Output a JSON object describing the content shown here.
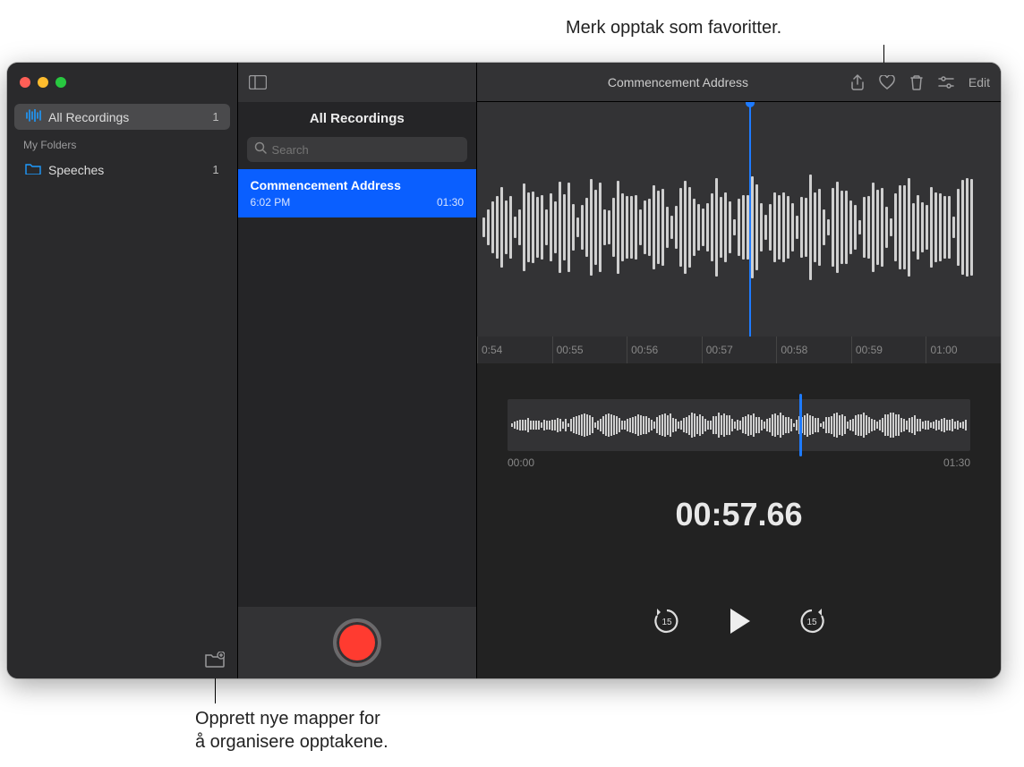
{
  "callouts": {
    "favorite": "Merk opptak som favoritter.",
    "folders_line1": "Opprett nye mapper for",
    "folders_line2": "å organisere opptakene."
  },
  "sidebar": {
    "all_recordings": "All Recordings",
    "all_count": "1",
    "group_label": "My Folders",
    "folders": [
      {
        "name": "Speeches",
        "count": "1"
      }
    ]
  },
  "list": {
    "header": "All Recordings",
    "search_placeholder": "Search",
    "recordings": [
      {
        "title": "Commencement Address",
        "time": "6:02 PM",
        "duration": "01:30"
      }
    ]
  },
  "detail": {
    "title": "Commencement Address",
    "edit": "Edit",
    "ticks": [
      "0:54",
      "00:55",
      "00:56",
      "00:57",
      "00:58",
      "00:59",
      "01:00"
    ],
    "overview_start": "00:00",
    "overview_end": "01:30",
    "big_time": "00:57.66",
    "skip_seconds": "15"
  }
}
